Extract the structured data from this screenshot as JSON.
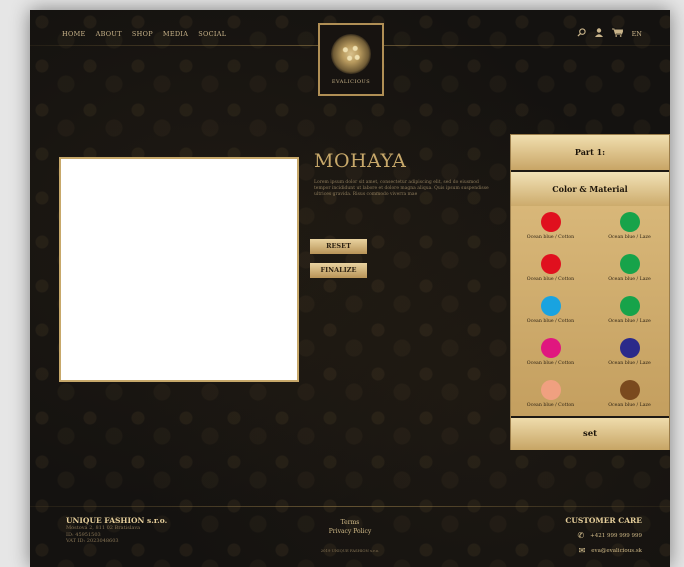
{
  "nav": {
    "items": [
      "HOME",
      "ABOUT",
      "SHOP",
      "MEDIA",
      "SOCIAL"
    ]
  },
  "logo": {
    "text": "EVALICIOUS"
  },
  "header_icons": {
    "search": "search-icon",
    "user": "user-icon",
    "cart": "cart-icon",
    "lang": "EN"
  },
  "product": {
    "title": "MOHAYA",
    "description": "Lorem ipsum dolor sit amet, consectetur adipiscing elit, sed do eiusmod tempor incididunt ut labore et dolore magna aliqua. Quis ipsum suspendisse ultrices gravida. Risus commodo viverra mae"
  },
  "buttons": {
    "reset": "RESET",
    "finalize": "FINALIZE"
  },
  "panel": {
    "part": "Part 1:",
    "section": "Color & Material",
    "swatches": [
      {
        "label": "Ocean blue / Cotton",
        "color": "#e0101e"
      },
      {
        "label": "Ocean blue / Laze",
        "color": "#17a34a"
      },
      {
        "label": "Ocean blue / Cotton",
        "color": "#e0101e"
      },
      {
        "label": "Ocean blue / Laze",
        "color": "#17a34a"
      },
      {
        "label": "Ocean blue / Cotton",
        "color": "#19a3e0"
      },
      {
        "label": "Ocean blue / Laze",
        "color": "#17a34a"
      },
      {
        "label": "Ocean blue / Cotton",
        "color": "#e0177f"
      },
      {
        "label": "Ocean blue / Laze",
        "color": "#2b2a8a"
      },
      {
        "label": "Ocean blue / Cotton",
        "color": "#f0a080"
      },
      {
        "label": "Ocean blue / Laze",
        "color": "#7a4a1e"
      }
    ],
    "set": "set"
  },
  "footer": {
    "company": "UNIQUE FASHION s.r.o.",
    "address": "Mostová 2, 811 02 Bratislava",
    "id": "ID: 45951503",
    "vat": "VAT ID: 2023048603",
    "terms": "Terms",
    "privacy": "Privacy Policy",
    "copyright": "2019 UNIQUE FASHION s.r.o.",
    "care_title": "CUSTOMER CARE",
    "phone": "+421 999 999 999",
    "email": "eva@evalicious.sk"
  },
  "colors": {
    "gold": "#c7a86a",
    "background": "#141210"
  }
}
